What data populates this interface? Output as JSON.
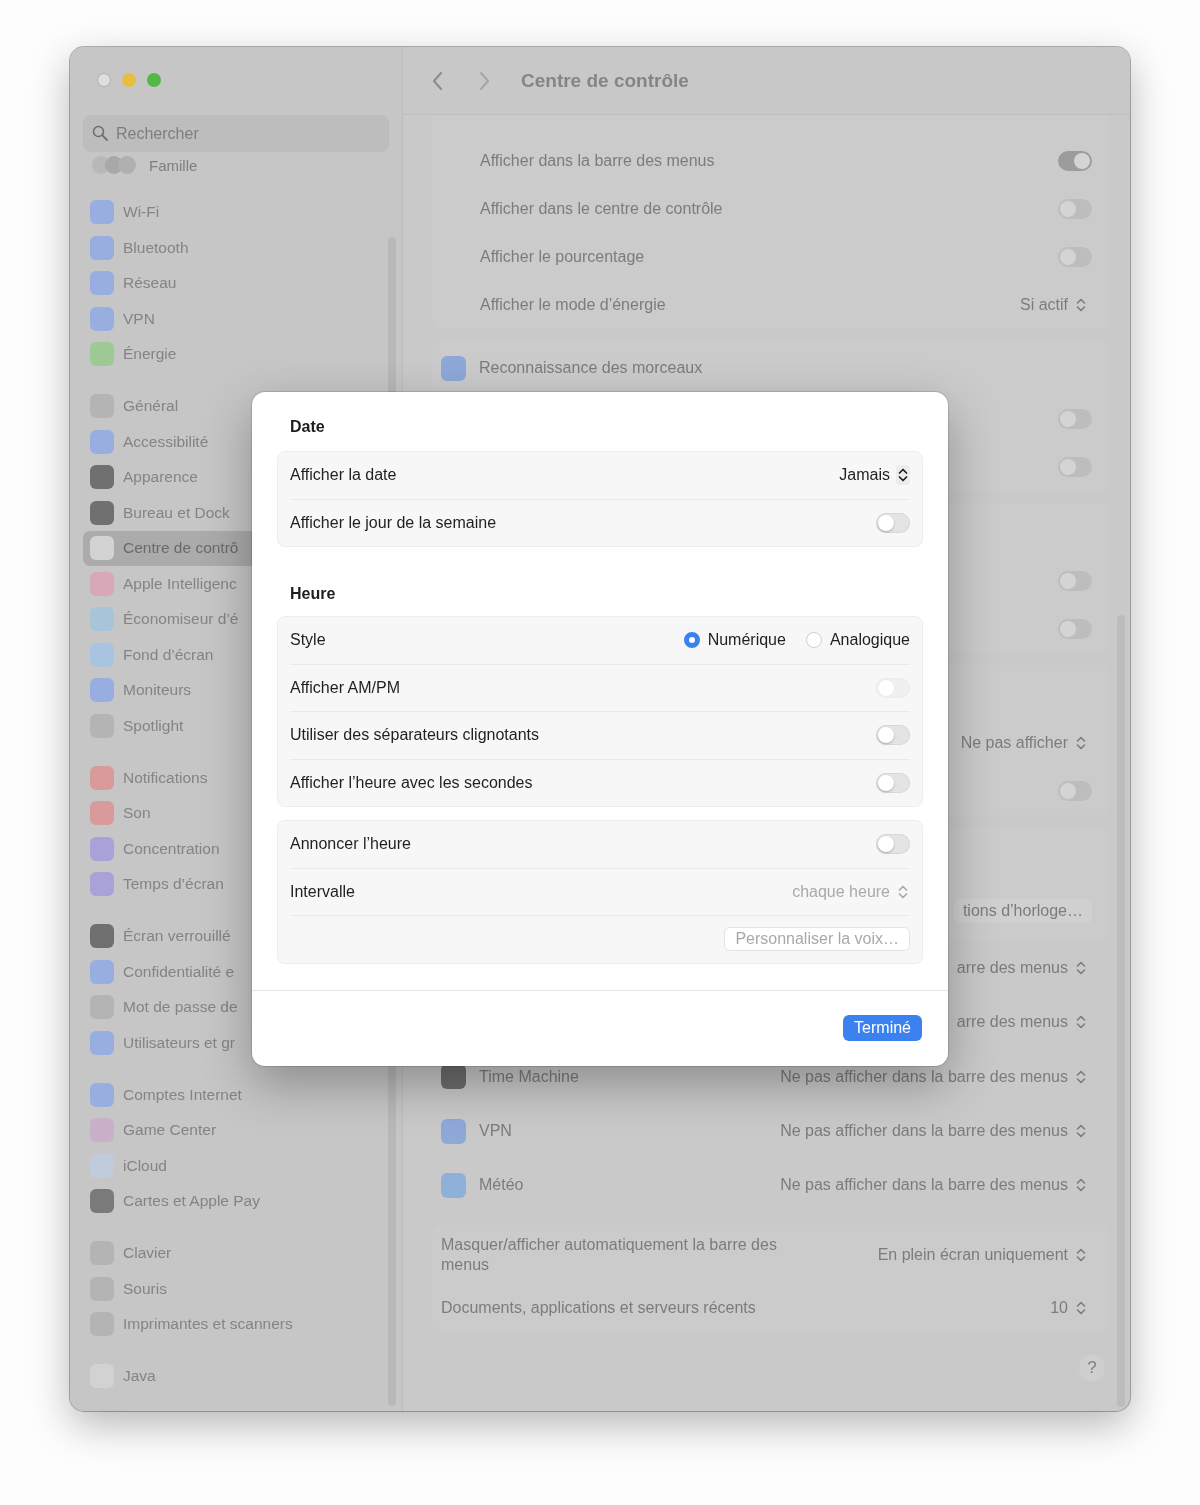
{
  "window": {
    "title": "Centre de contrôle"
  },
  "search": {
    "placeholder": "Rechercher"
  },
  "sidebar": {
    "account": "Famille",
    "groups": [
      {
        "items": [
          {
            "label": "Wi-Fi",
            "color": "#98aee0",
            "selected": false
          },
          {
            "label": "Bluetooth",
            "color": "#98aee0",
            "selected": false
          },
          {
            "label": "Réseau",
            "color": "#98aee0",
            "selected": false
          },
          {
            "label": "VPN",
            "color": "#98aee0",
            "selected": false
          },
          {
            "label": "Énergie",
            "color": "#9cc994",
            "selected": false
          }
        ]
      },
      {
        "items": [
          {
            "label": "Général",
            "color": "#b4b4b4",
            "selected": false
          },
          {
            "label": "Accessibilité",
            "color": "#98aee0",
            "selected": false
          },
          {
            "label": "Apparence",
            "color": "#707070",
            "selected": false
          },
          {
            "label": "Bureau et Dock",
            "color": "#707070",
            "selected": false
          },
          {
            "label": "Centre de contrô",
            "color": "#d2d2d2",
            "selected": true
          },
          {
            "label": "Apple Intelligenc",
            "color": "#d6a8b8",
            "selected": false
          },
          {
            "label": "Économiseur d’é",
            "color": "#a8c4d8",
            "selected": false
          },
          {
            "label": "Fond d’écran",
            "color": "#a8c4e0",
            "selected": false
          },
          {
            "label": "Moniteurs",
            "color": "#98aee0",
            "selected": false
          },
          {
            "label": "Spotlight",
            "color": "#b4b4b4",
            "selected": false
          }
        ]
      },
      {
        "items": [
          {
            "label": "Notifications",
            "color": "#d99a9a",
            "selected": false
          },
          {
            "label": "Son",
            "color": "#d99a9a",
            "selected": false
          },
          {
            "label": "Concentration",
            "color": "#a9a2d8",
            "selected": false
          },
          {
            "label": "Temps d’écran",
            "color": "#a9a2d8",
            "selected": false
          }
        ]
      },
      {
        "items": [
          {
            "label": "Écran verrouillé",
            "color": "#6f6f6f",
            "selected": false
          },
          {
            "label": "Confidentialité e",
            "color": "#98aee0",
            "selected": false
          },
          {
            "label": "Mot de passe de",
            "color": "#b4b4b4",
            "selected": false
          },
          {
            "label": "Utilisateurs et gr",
            "color": "#98aee0",
            "selected": false
          }
        ]
      },
      {
        "items": [
          {
            "label": "Comptes Internet",
            "color": "#98aee0",
            "selected": false
          },
          {
            "label": "Game Center",
            "color": "#c8b0c8",
            "selected": false
          },
          {
            "label": "iCloud",
            "color": "#c0ccdc",
            "selected": false
          },
          {
            "label": "Cartes et Apple Pay",
            "color": "#7a7a7a",
            "selected": false
          }
        ]
      },
      {
        "items": [
          {
            "label": "Clavier",
            "color": "#b4b4b4",
            "selected": false
          },
          {
            "label": "Souris",
            "color": "#b4b4b4",
            "selected": false
          },
          {
            "label": "Imprimantes et scanners",
            "color": "#b4b4b4",
            "selected": false
          }
        ]
      },
      {
        "items": [
          {
            "label": "Java",
            "color": "#d2d2d2",
            "selected": false
          }
        ]
      }
    ]
  },
  "main": {
    "sections": [
      {
        "rows": [
          {
            "kind": "toggle",
            "label": "Afficher dans la barre des menus",
            "on": true
          },
          {
            "kind": "toggle",
            "label": "Afficher dans le centre de contrôle",
            "on": false
          },
          {
            "kind": "toggle",
            "label": "Afficher le pourcentage",
            "on": false
          },
          {
            "kind": "popup",
            "label": "Afficher le mode d’énergie",
            "value": "Si actif"
          }
        ]
      },
      {
        "title": "Reconnaissance des morceaux",
        "color": "#8ea8d8",
        "rows": [
          {
            "kind": "toggle",
            "on": false
          },
          {
            "kind": "toggle",
            "on": false
          }
        ]
      },
      {
        "rows": [
          {
            "kind": "toggle",
            "on": false
          },
          {
            "kind": "toggle",
            "on": false
          }
        ]
      },
      {
        "rows": [
          {
            "kind": "popup",
            "value": "Ne pas afficher"
          },
          {
            "kind": "toggle",
            "on": false
          }
        ]
      },
      {
        "rows": [
          {
            "kind": "button",
            "value": "tions d’horloge…"
          }
        ]
      }
    ],
    "menu_items": [
      {
        "value": "arre des menus"
      },
      {
        "value": "arre des menus"
      },
      {
        "label": "Time Machine",
        "color": "#6e6e6e",
        "value": "Ne pas afficher dans la barre des menus"
      },
      {
        "label": "VPN",
        "color": "#8ea8d8",
        "value": "Ne pas afficher dans la barre des menus"
      },
      {
        "label": "Météo",
        "color": "#8fb0d8",
        "value": "Ne pas afficher dans la barre des menus"
      }
    ],
    "options": [
      {
        "label": "Masquer/afficher automatiquement la barre des menus",
        "value": "En plein écran uniquement"
      },
      {
        "label": "Documents, applications et serveurs récents",
        "value": "10"
      }
    ],
    "help": "?"
  },
  "dialog": {
    "groups": [
      {
        "title": "Date",
        "rows": [
          {
            "kind": "popup",
            "label": "Afficher la date",
            "value": "Jamais",
            "disabled": false
          },
          {
            "kind": "toggle",
            "label": "Afficher le jour de la semaine",
            "on": false,
            "disabled": false
          }
        ]
      },
      {
        "title": "Heure",
        "rows": [
          {
            "kind": "radio",
            "label": "Style",
            "disabled": false,
            "options": [
              {
                "label": "Numérique",
                "selected": true
              },
              {
                "label": "Analogique",
                "selected": false
              }
            ]
          },
          {
            "kind": "toggle",
            "label": "Afficher AM/PM",
            "on": false,
            "disabled": true
          },
          {
            "kind": "toggle",
            "label": "Utiliser des séparateurs clignotants",
            "on": false,
            "disabled": false
          },
          {
            "kind": "toggle",
            "label": "Afficher l’heure avec les secondes",
            "on": false,
            "disabled": false
          }
        ]
      },
      {
        "rows": [
          {
            "kind": "toggle",
            "label": "Annoncer l’heure",
            "on": false,
            "disabled": false
          },
          {
            "kind": "popup",
            "label": "Intervalle",
            "value": "chaque heure",
            "disabled": true
          },
          {
            "kind": "button",
            "value": "Personnaliser la voix…",
            "disabled": true
          }
        ]
      }
    ],
    "done": "Terminé"
  }
}
